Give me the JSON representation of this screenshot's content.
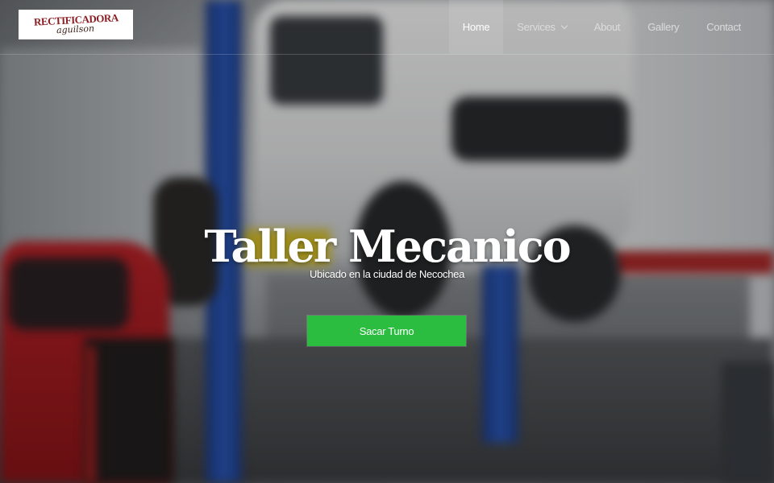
{
  "brand": {
    "logo_line1": "RECTIFICADORA",
    "logo_line2": "aguilson"
  },
  "nav": {
    "items": [
      {
        "label": "Home",
        "active": true
      },
      {
        "label": "Services",
        "has_dropdown": true
      },
      {
        "label": "About"
      },
      {
        "label": "Gallery"
      },
      {
        "label": "Contact"
      }
    ]
  },
  "hero": {
    "title": "Taller Mecanico",
    "subtitle": "Ubicado en la ciudad de Necochea",
    "cta_label": "Sacar Turno"
  },
  "colors": {
    "cta": "#2bbd3f",
    "logo_red": "#8a1e22",
    "text": "#ffffff"
  }
}
